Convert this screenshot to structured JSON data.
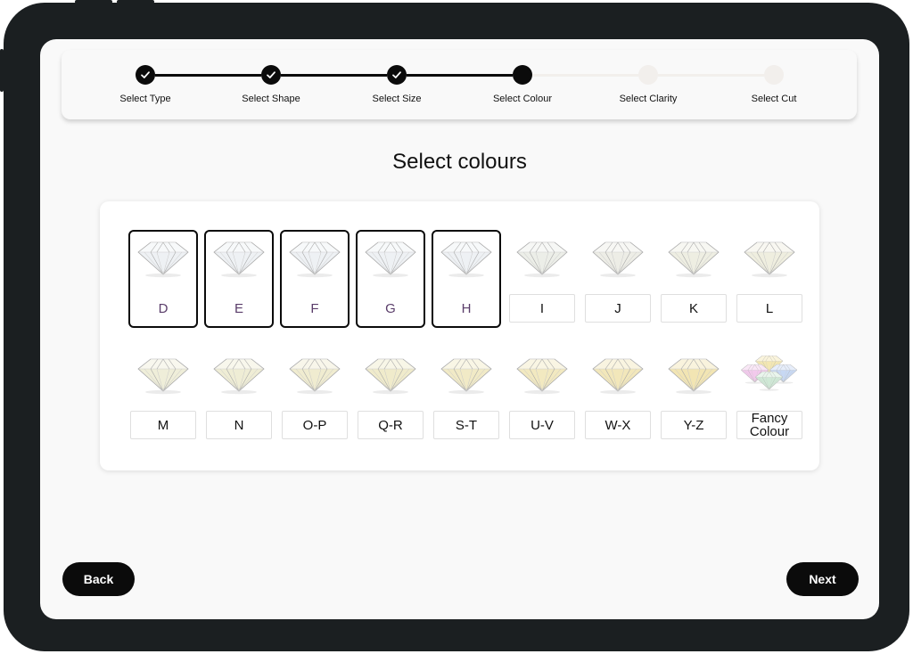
{
  "steps": [
    {
      "label": "Select Type",
      "state": "done"
    },
    {
      "label": "Select Shape",
      "state": "done"
    },
    {
      "label": "Select Size",
      "state": "done"
    },
    {
      "label": "Select Colour",
      "state": "current"
    },
    {
      "label": "Select Clarity",
      "state": "pending"
    },
    {
      "label": "Select Cut",
      "state": "pending"
    }
  ],
  "title": "Select colours",
  "colour_rows": [
    [
      {
        "label": "D",
        "selected": true,
        "tint": "#eef1f4"
      },
      {
        "label": "E",
        "selected": true,
        "tint": "#eef1f4"
      },
      {
        "label": "F",
        "selected": true,
        "tint": "#eef1f4"
      },
      {
        "label": "G",
        "selected": true,
        "tint": "#eef1f4"
      },
      {
        "label": "H",
        "selected": true,
        "tint": "#eef1f4"
      },
      {
        "label": "I",
        "selected": false,
        "tint": "#eceee8"
      },
      {
        "label": "J",
        "selected": false,
        "tint": "#ededE6"
      },
      {
        "label": "K",
        "selected": false,
        "tint": "#eeeee2"
      },
      {
        "label": "L",
        "selected": false,
        "tint": "#efeedf"
      }
    ],
    [
      {
        "label": "M",
        "selected": false,
        "tint": "#efeed9"
      },
      {
        "label": "N",
        "selected": false,
        "tint": "#efedd5"
      },
      {
        "label": "O-P",
        "selected": false,
        "tint": "#f0ecd0"
      },
      {
        "label": "Q-R",
        "selected": false,
        "tint": "#f0ebcb"
      },
      {
        "label": "S-T",
        "selected": false,
        "tint": "#f1eac6"
      },
      {
        "label": "U-V",
        "selected": false,
        "tint": "#f2e9c0"
      },
      {
        "label": "W-X",
        "selected": false,
        "tint": "#f2e7ba"
      },
      {
        "label": "Y-Z",
        "selected": false,
        "tint": "#f2e5b3"
      },
      {
        "label": "Fancy\nColour",
        "selected": false,
        "tint": "fancy"
      }
    ]
  ],
  "icons": {
    "check": "check-icon",
    "gem": "diamond-icon"
  },
  "colors": {
    "accent": "#0b0b0b",
    "frame": "#1b1f21",
    "screen": "#f9f9f9",
    "pending": "#f2efec",
    "selected_label": "#5a3d6a"
  },
  "nav": {
    "back_label": "Back",
    "next_label": "Next"
  }
}
